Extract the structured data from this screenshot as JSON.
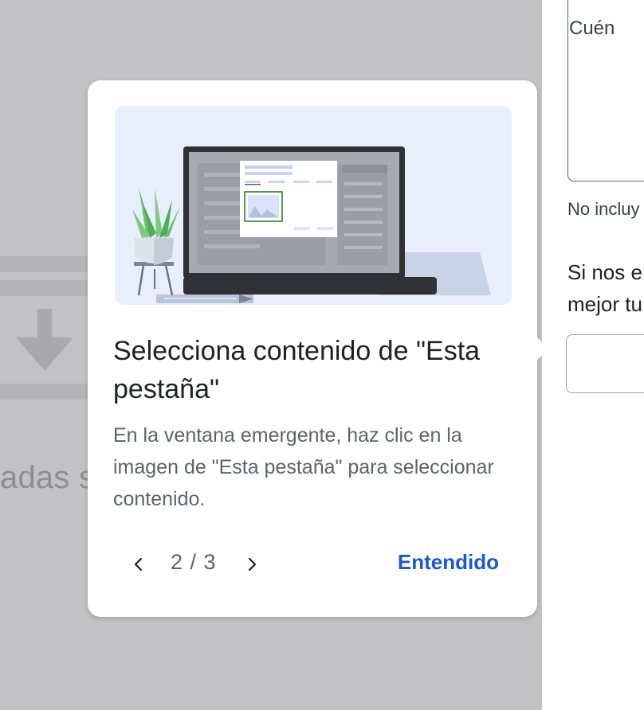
{
  "background": {
    "partial_text": "adas s"
  },
  "side_panel": {
    "textarea_text": "Cuén",
    "hint_text": "No incluy",
    "paragraph_lines": [
      "Si nos e",
      "mejor tu"
    ]
  },
  "tooltip": {
    "title": "Selecciona contenido de \"Esta pestaña\"",
    "body": "En la ventana emergente, haz clic en la imagen de \"Esta pestaña\" para seleccionar contenido.",
    "page_indicator": "2 / 3",
    "got_it_label": "Entendido",
    "icons": {
      "prev": "chevron-left-icon",
      "next": "chevron-right-icon"
    }
  },
  "colors": {
    "accent": "#1a56d6",
    "overlay": "#c2c2c4",
    "illustration_bg": "#e8eefc"
  }
}
